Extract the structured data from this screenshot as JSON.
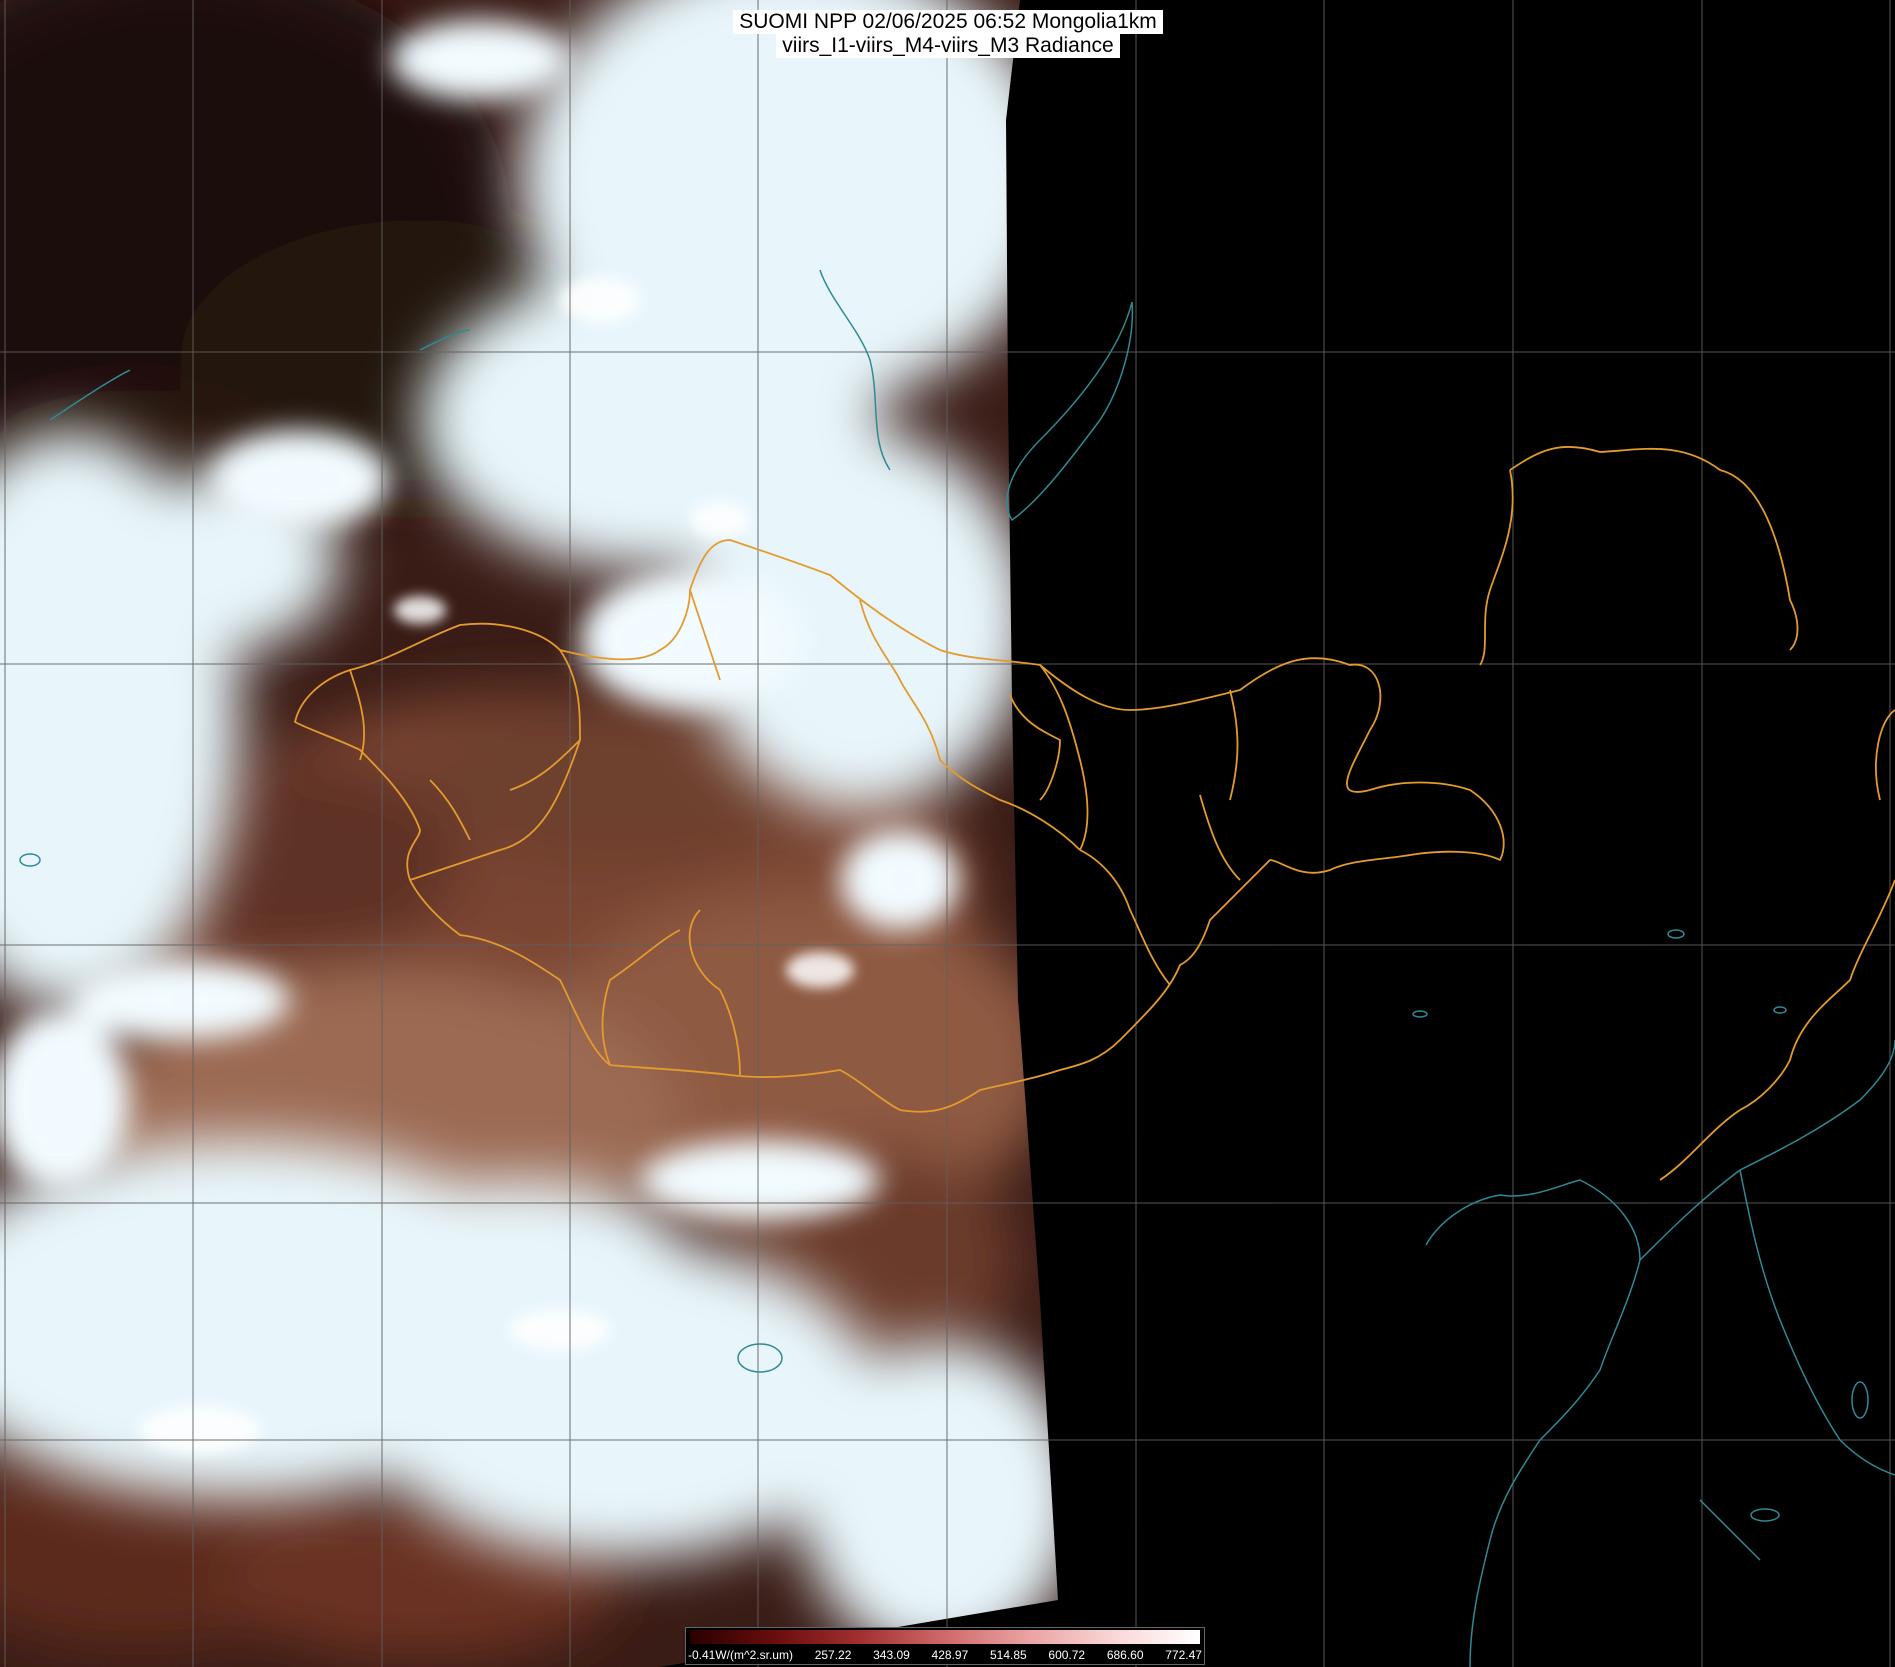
{
  "title": {
    "line1": "SUOMI NPP 02/06/2025 06:52 Mongolia1km",
    "line2": "viirs_I1-viirs_M4-viirs_M3 Radiance"
  },
  "colorbar": {
    "labels": [
      "-0.41W/(m^2.sr.um)",
      "257.22",
      "343.09",
      "428.97",
      "514.85",
      "600.72",
      "686.60",
      "772.47"
    ],
    "colors": [
      "#2a0000",
      "#6a0d0d",
      "#a23030",
      "#cf6a6a",
      "#eba3a3",
      "#fad7d7",
      "#ffffff"
    ]
  },
  "colors": {
    "cloud": "#e8f6fb",
    "land_dark": "#2a1210",
    "land_brown": "#7a4a36",
    "desert": "#9c6a52",
    "night": "#000000",
    "border_lines": "#e39b2e",
    "coast_lines": "#2f8a93",
    "grid": "#606060"
  }
}
